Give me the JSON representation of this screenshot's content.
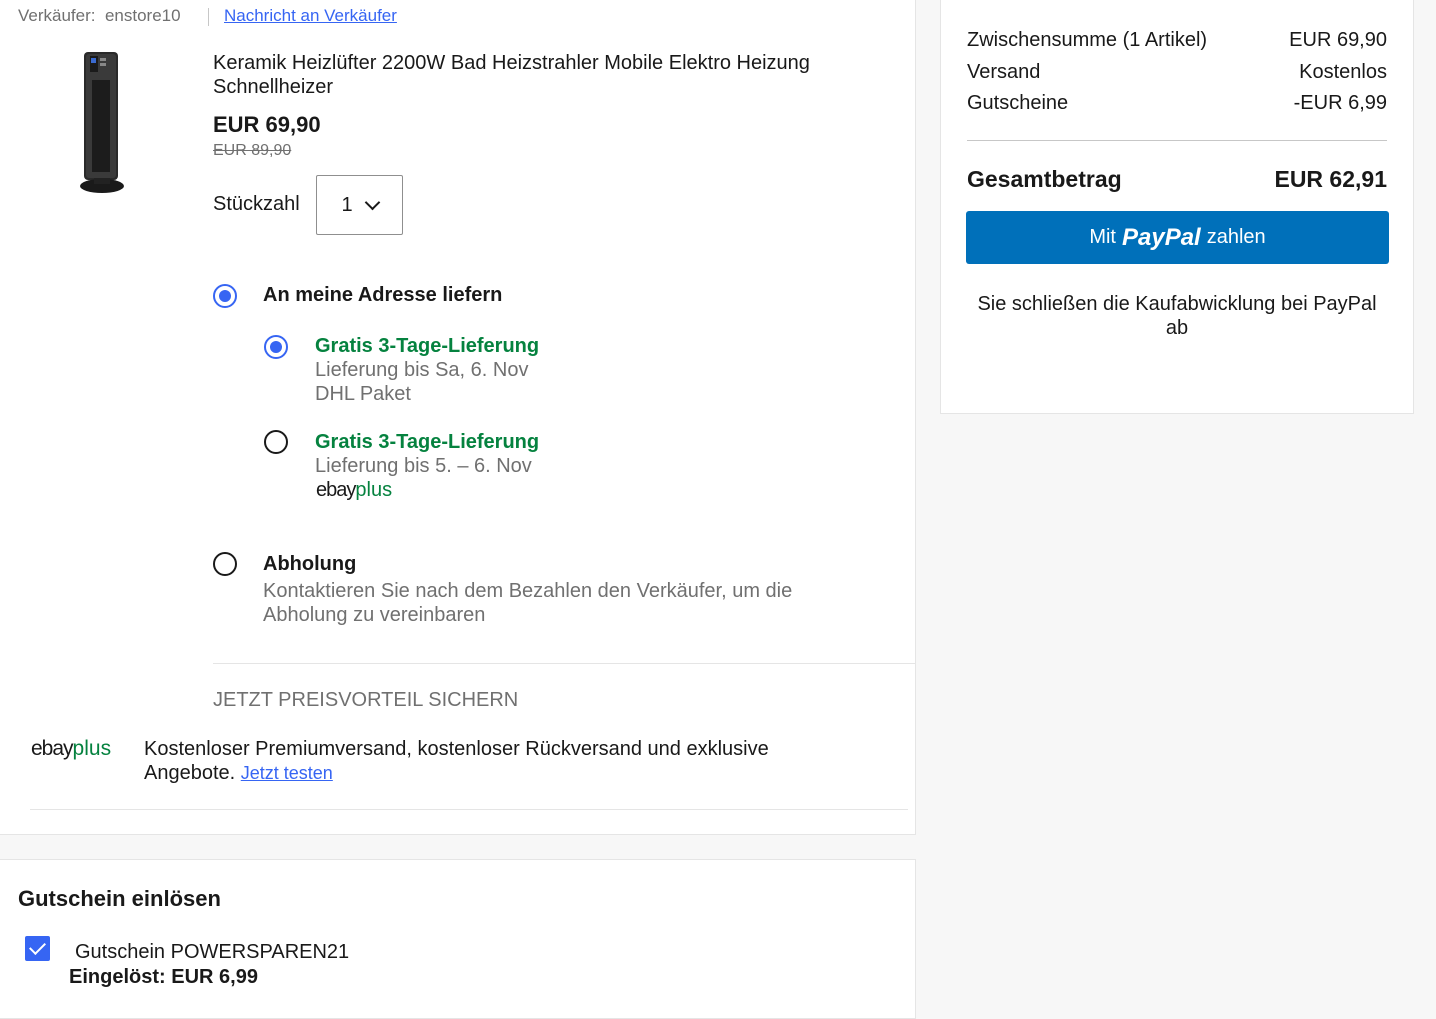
{
  "seller": {
    "label": "Verkäufer:",
    "name": "enstore10",
    "message_link": "Nachricht an Verkäufer"
  },
  "product": {
    "title": "Keramik Heizlüfter 2200W Bad Heizstrahler Mobile Elektro Heizung Schnellheizer",
    "price": "EUR 69,90",
    "old_price": "EUR 89,90",
    "qty_label": "Stückzahl",
    "qty_value": "1"
  },
  "delivery": {
    "address_label": "An meine Adresse liefern",
    "options": [
      {
        "title": "Gratis 3-Tage-Lieferung",
        "line1": "Lieferung bis Sa, 6. Nov",
        "line2": "DHL Paket",
        "selected": true
      },
      {
        "title": "Gratis 3-Tage-Lieferung",
        "line1": "Lieferung bis 5. – 6. Nov",
        "line2": "",
        "selected": false
      }
    ],
    "pickup_label": "Abholung",
    "pickup_text": "Kontaktieren Sie nach dem Bezahlen den Verkäufer, um die Abholung zu vereinbaren"
  },
  "ebay_plus": {
    "logo_ebay": "ebay",
    "logo_plus": "plus",
    "heading": "JETZT PREISVORTEIL SICHERN",
    "text": "Kostenloser Premiumversand, kostenloser Rückversand und exklusive Angebote.",
    "link": "Jetzt testen"
  },
  "voucher": {
    "heading": "Gutschein einlösen",
    "code_label": "Gutschein POWERSPAREN21",
    "redeemed": "Eingelöst: EUR 6,99",
    "checked": true
  },
  "summary": {
    "rows": [
      {
        "label": "Zwischensumme (1 Artikel)",
        "value": "EUR 69,90"
      },
      {
        "label": "Versand",
        "value": "Kostenlos"
      },
      {
        "label": "Gutscheine",
        "value": "-EUR 6,99"
      }
    ],
    "total_label": "Gesamtbetrag",
    "total_value": "EUR 62,91",
    "paypal_prefix": "Mit",
    "paypal_word": "PayPal",
    "paypal_suffix": "zahlen",
    "paypal_note": "Sie schließen die Kaufabwicklung bei PayPal ab"
  },
  "colors": {
    "accent_blue": "#3665f3",
    "paypal_blue": "#0070ba",
    "green": "#05823f"
  }
}
